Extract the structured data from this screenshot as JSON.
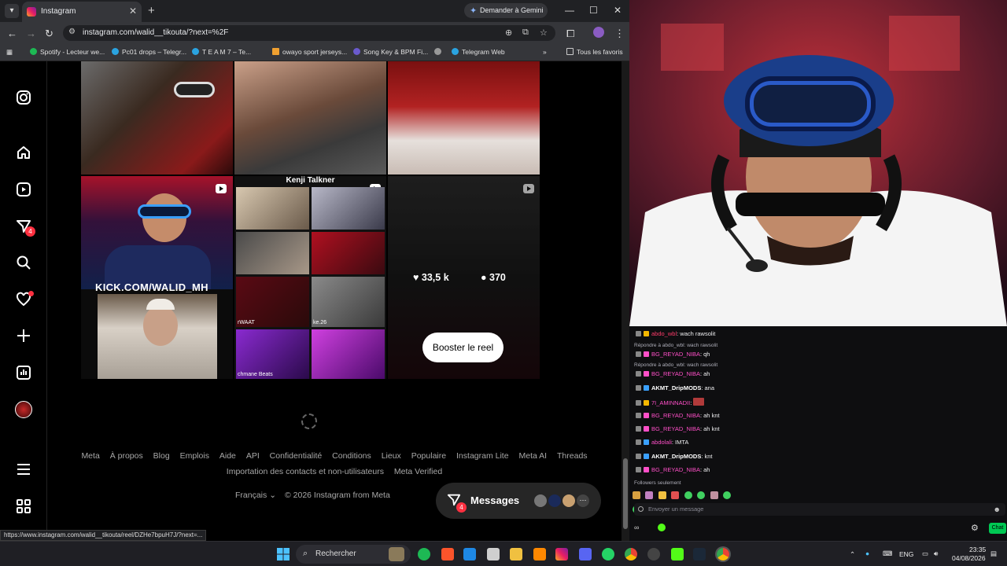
{
  "browser": {
    "tab_title": "Instagram",
    "gemini_label": "Demander à Gemini",
    "url": "instagram.com/walid__tikouta/?next=%2F",
    "bookmarks": [
      "Spotify - Lecteur we...",
      "Pc01 drops – Telegr...",
      "T E A M 7 – Te...",
      "owayo sport jerseys...",
      "Song Key & BPM Fi...",
      "Telegram Web"
    ],
    "all_bookmarks_label": "Tous les favoris",
    "status_url": "https://www.instagram.com/walid__tikouta/reel/DZHe7bpuH7J/?next=..."
  },
  "instagram": {
    "nav_icons": [
      "instagram-logo-icon",
      "home-icon",
      "reels-icon",
      "messages-icon",
      "search-icon",
      "notifications-icon",
      "create-icon",
      "dashboard-icon",
      "profile-avatar",
      "menu-icon",
      "more-apps-icon"
    ],
    "messages_badge": "4",
    "grid_text": {
      "kick_banner": "KICK.COM/WALID_MH",
      "kenji_banner": "Kenji Talkner",
      "collage_captions": [
        "rWAAT",
        "ke.26",
        "chmane Beats"
      ]
    },
    "hover_stats": {
      "likes": "33,5 k",
      "comments": "370"
    },
    "boost_label": "Booster le reel",
    "footer_links": [
      "Meta",
      "À propos",
      "Blog",
      "Emplois",
      "Aide",
      "API",
      "Confidentialité",
      "Conditions",
      "Lieux",
      "Populaire",
      "Instagram Lite",
      "Meta AI",
      "Threads"
    ],
    "footer_links_2": [
      "Importation des contacts et non-utilisateurs",
      "Meta Verified"
    ],
    "language": "Français",
    "copyright": "© 2026 Instagram from Meta",
    "messages_label": "Messages",
    "messages_count": "4"
  },
  "chat": {
    "lines": [
      {
        "type": "msg",
        "user": "abdo_wbl",
        "color": "#ff3b6b",
        "text": "wach rawsolit"
      },
      {
        "type": "reply",
        "text": "Répondre à abdo_wbl: wach rawsolit"
      },
      {
        "type": "msg",
        "user": "BG_REYAD_NIBA",
        "color": "#ff4fc8",
        "text": "qh"
      },
      {
        "type": "reply",
        "text": "Répondre à abdo_wbl: wach rawsolit"
      },
      {
        "type": "msg",
        "user": "BG_REYAD_NIBA",
        "color": "#ff4fc8",
        "text": "ah"
      },
      {
        "type": "msg",
        "user": "AKMT_DripMODS",
        "color": "#ffffff",
        "text": "ana"
      },
      {
        "type": "msg",
        "user": "7I_AMINNADII",
        "color": "#ff4fc8",
        "text": ""
      },
      {
        "type": "msg",
        "user": "BG_REYAD_NIBA",
        "color": "#ff4fc8",
        "text": "ah knt"
      },
      {
        "type": "msg",
        "user": "BG_REYAD_NIBA",
        "color": "#ff4fc8",
        "text": "ah knt"
      },
      {
        "type": "msg",
        "user": "abdolali",
        "color": "#ff4fc8",
        "text": "IMTA"
      },
      {
        "type": "msg",
        "user": "AKMT_DripMODS",
        "color": "#ffffff",
        "text": "knt"
      },
      {
        "type": "msg",
        "user": "BG_REYAD_NIBA",
        "color": "#ff4fc8",
        "text": "ah"
      }
    ],
    "followers_only": "Followers seulement",
    "input_placeholder": "Envoyer un message",
    "send_label": "Chat"
  },
  "taskbar": {
    "search_label": "Rechercher",
    "language": "ENG",
    "time": "23:35",
    "date": "04/08/2026"
  }
}
